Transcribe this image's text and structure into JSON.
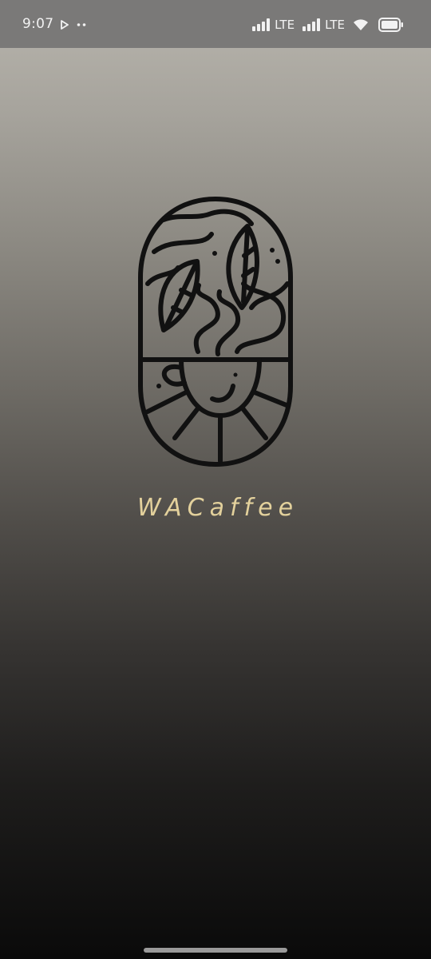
{
  "status_bar": {
    "time": "9:07",
    "network_1": "LTE",
    "network_2": "LTE",
    "icons": [
      "play-store-notification-icon",
      "more-notifications-dots-icon",
      "signal-icon",
      "signal-icon",
      "wifi-icon",
      "battery-icon"
    ]
  },
  "splash": {
    "logo": "coffee-cup-with-leaves-logo",
    "brand_name": "WACaffee",
    "colors": {
      "brand_text": "#e3d19c",
      "logo_stroke": "#111111",
      "status_bar": "#7a7978"
    }
  }
}
